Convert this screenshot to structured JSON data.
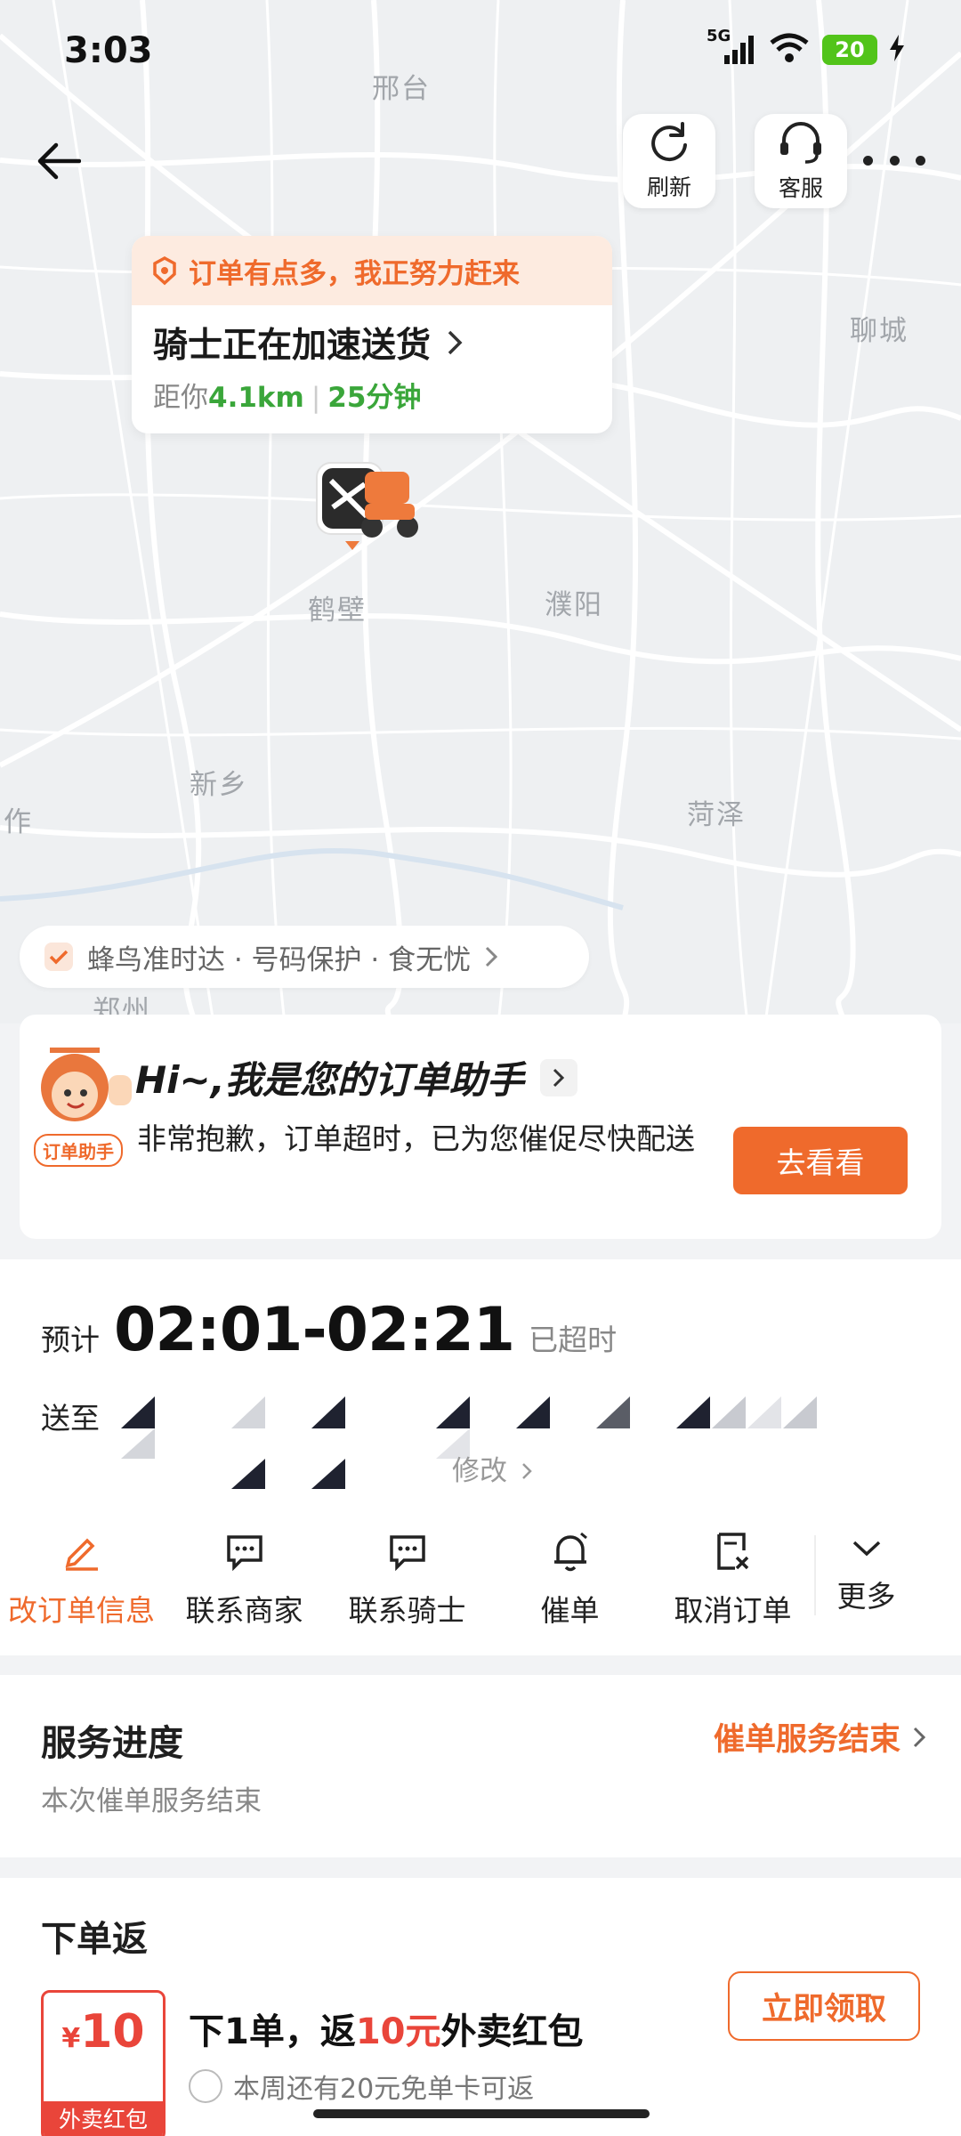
{
  "status_bar": {
    "time": "3:03",
    "network": "5G",
    "battery": "20"
  },
  "map": {
    "cities": [
      "邢台",
      "聊城",
      "鹤壁",
      "濮阳",
      "新乡",
      "菏泽",
      "作",
      "郑州"
    ]
  },
  "toolbar": {
    "refresh_label": "刷新",
    "service_label": "客服"
  },
  "rider_card": {
    "banner": "订单有点多，我正努力赶来",
    "title": "骑士正在加速送货",
    "distance_prefix": "距你",
    "distance": "4.1km",
    "separator": "|",
    "eta": "25分钟"
  },
  "guarantee": {
    "text": "蜂鸟准时达 · 号码保护 · 食无忧"
  },
  "assistant": {
    "badge": "订单助手",
    "title": "Hi~,我是您的订单助手",
    "message": "非常抱歉，订单超时，已为您催促尽快配送",
    "button": "去看看"
  },
  "order": {
    "eta_label": "预计",
    "eta_range": "02:01-02:21",
    "late": "已超时",
    "send_to": "送至",
    "edit": "修改",
    "actions": [
      "改订单信息",
      "联系商家",
      "联系骑士",
      "催单",
      "取消订单",
      "更多"
    ]
  },
  "service": {
    "title": "服务进度",
    "status": "催单服务结束",
    "subtitle": "本次催单服务结束"
  },
  "reward": {
    "title": "下单返",
    "coupon_currency": "¥",
    "coupon_amount": "10",
    "coupon_label": "外卖红包",
    "main_prefix": "下1单，返",
    "main_amount": "10元",
    "main_suffix": "外卖红包",
    "sub": "本周还有20元免单卡可返",
    "button": "立即领取"
  },
  "colors": {
    "accent": "#ef6a2c",
    "green": "#3aa63a",
    "red": "#e9453a"
  }
}
